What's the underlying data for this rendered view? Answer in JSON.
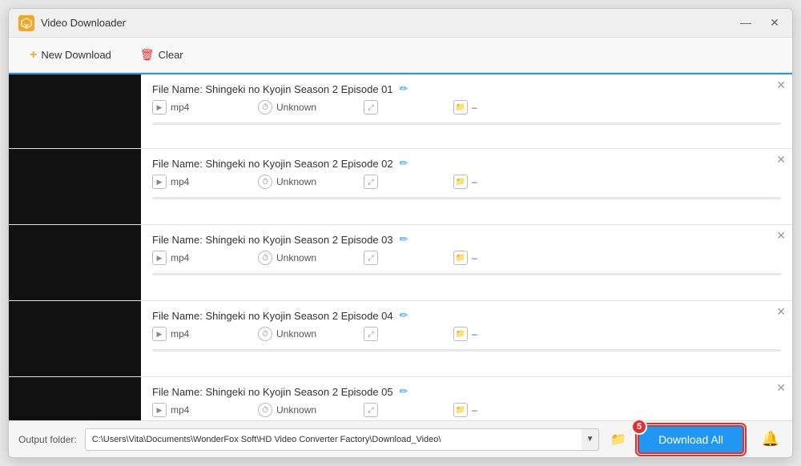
{
  "window": {
    "title": "Video Downloader",
    "controls": {
      "minimize": "—",
      "close": "✕"
    }
  },
  "toolbar": {
    "new_download_label": "New Download",
    "clear_label": "Clear"
  },
  "items": [
    {
      "file_name": "File Name: Shingeki no Kyojin Season 2 Episode 01",
      "format": "mp4",
      "duration": "Unknown",
      "size": "",
      "folder": "–",
      "active": true,
      "progress": 0
    },
    {
      "file_name": "File Name: Shingeki no Kyojin Season 2 Episode 02",
      "format": "mp4",
      "duration": "Unknown",
      "size": "",
      "folder": "–",
      "active": false,
      "progress": 0
    },
    {
      "file_name": "File Name: Shingeki no Kyojin Season 2 Episode 03",
      "format": "mp4",
      "duration": "Unknown",
      "size": "",
      "folder": "–",
      "active": false,
      "progress": 0
    },
    {
      "file_name": "File Name: Shingeki no Kyojin Season 2 Episode 04",
      "format": "mp4",
      "duration": "Unknown",
      "size": "",
      "folder": "–",
      "active": false,
      "progress": 0
    },
    {
      "file_name": "File Name: Shingeki no Kyojin Season 2 Episode 05",
      "format": "mp4",
      "duration": "Unknown",
      "size": "",
      "folder": "–",
      "active": false,
      "progress": 0
    }
  ],
  "bottom_bar": {
    "output_label": "Output folder:",
    "output_path": "C:\\Users\\Vita\\Documents\\WonderFox Soft\\HD Video Converter Factory\\Download_Video\\",
    "download_all_label": "Download All",
    "badge_count": "5"
  }
}
